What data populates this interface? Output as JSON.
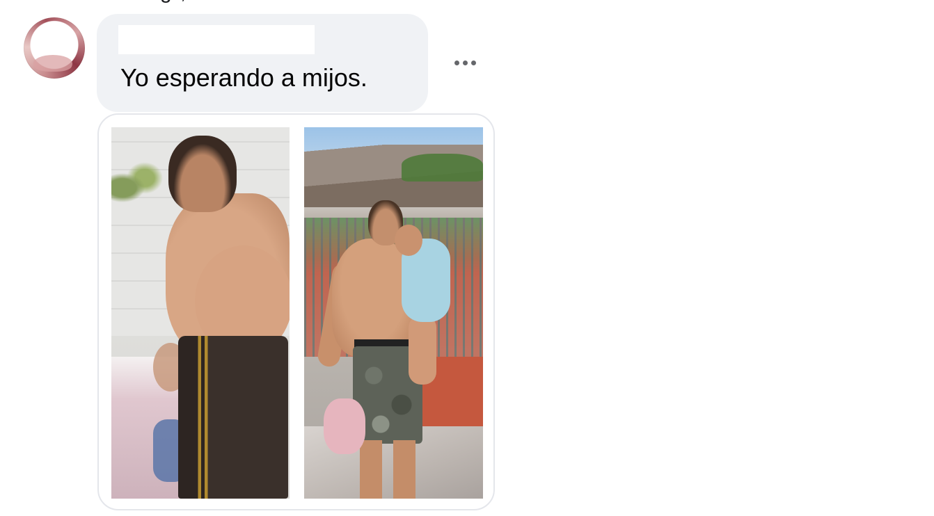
{
  "comment": {
    "author": "",
    "text": "Yo esperando a mijos.",
    "previous_cutoff_text": "g        ,"
  },
  "more_button": {
    "icon": "more-horizontal-icon"
  },
  "attachment": {
    "type": "image",
    "panels": [
      {
        "id": "left",
        "description_icon": "photo"
      },
      {
        "id": "right",
        "description_icon": "photo"
      }
    ]
  },
  "colors": {
    "bubble_bg": "#f0f2f5",
    "text": "#050505",
    "icon_gray": "#65676b",
    "border": "#e4e6eb"
  }
}
